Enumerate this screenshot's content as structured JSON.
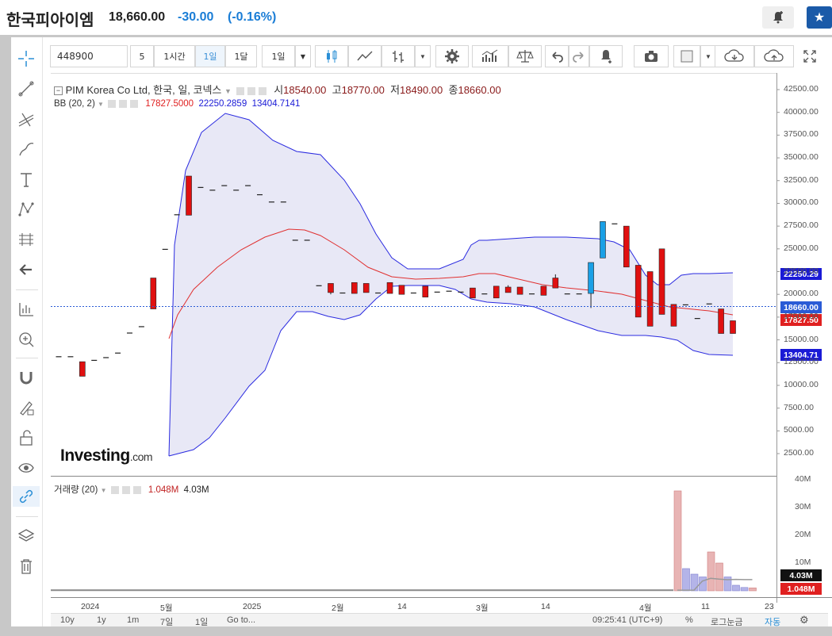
{
  "header": {
    "title": "한국피아이엠",
    "price": "18,660.00",
    "change": "-30.00",
    "change_pct": "(-0.16%)",
    "colors": {
      "down": "#1a7dd6"
    },
    "icons": [
      "bell-plus-icon",
      "star-icon"
    ]
  },
  "toolbar": {
    "symbol_value": "448900",
    "interval_5": "5",
    "interval_1h": "1시간",
    "interval_1d": "1일",
    "interval_1w": "1달",
    "interval_select": "1일",
    "icons": [
      "candles-icon",
      "line-chart-icon",
      "bar-chart-icon",
      "gear-icon",
      "indicators-icon",
      "scale-icon",
      "undo-icon",
      "redo-icon",
      "alert-icon",
      "camera-icon",
      "color-box-icon",
      "cloud-download-icon",
      "cloud-upload-icon",
      "fullscreen-icon"
    ]
  },
  "legend": {
    "symbol_line": "PIM Korea Co Ltd, 한국, 일, 코넥스",
    "open_label": "시",
    "open": "18540.00",
    "high_label": "고",
    "high": "18770.00",
    "low_label": "저",
    "low": "18490.00",
    "close_label": "종",
    "close": "18660.00",
    "bb_label": "BB (20, 2)",
    "bb_mid": "17827.5000",
    "bb_upper": "22250.2859",
    "bb_lower": "13404.7141",
    "vol_label": "거래량 (20)",
    "vol_value": "1.048M",
    "vol_ma": "4.03M"
  },
  "watermark": {
    "brand": "Investing",
    "suffix": ".com"
  },
  "axis_tags": {
    "bb_upper": "22250.29",
    "last": "18660.00",
    "bb_mid": "17827.50",
    "bb_lower": "13404.71",
    "vol_ma": "4.03M",
    "vol": "1.048M",
    "colors": {
      "upper": "#1a1ad6",
      "last": "#2a5bd6",
      "mid": "#e02020",
      "lower": "#1a1ad6",
      "vol_ma": "#111111",
      "vol": "#e02020"
    }
  },
  "bottom_bar": {
    "ranges": [
      "10y",
      "1y",
      "1m",
      "7일",
      "1일"
    ],
    "goto": "Go to...",
    "time": "09:25:41 (UTC+9)",
    "pct": "%",
    "log": "로그눈금",
    "auto": "자동"
  },
  "sidebar": {
    "icons": [
      "crosshair-icon",
      "trendline-icon",
      "fib-icon",
      "brush-icon",
      "text-icon",
      "pattern-icon",
      "measure-icon",
      "back-arrow-icon",
      "ruler-icon",
      "zoom-in-icon",
      "magnet-icon",
      "lock-pencil-icon",
      "unlock-icon",
      "eye-icon",
      "link-icon",
      "layers-icon",
      "trash-icon"
    ]
  },
  "chart_data": [
    {
      "type": "candlestick",
      "title": "PIM Korea Co Ltd, 한국, 일, 코넥스",
      "y_axis_ticks": [
        "42500.00",
        "40000.00",
        "37500.00",
        "35000.00",
        "32500.00",
        "30000.00",
        "27500.00",
        "25000.00",
        "22500.00",
        "20000.00",
        "17500.00",
        "15000.00",
        "12500.00",
        "10000.00",
        "7500.00",
        "5000.00",
        "2500.00"
      ],
      "x_axis_ticks": [
        "2024",
        "5월",
        "2025",
        "2월",
        "14",
        "3월",
        "14",
        "4월",
        "11",
        "23"
      ],
      "ylim": [
        0,
        43750
      ],
      "candles": [
        {
          "o": 13200,
          "h": 13200,
          "l": 13200,
          "c": 13200
        },
        {
          "o": 13200,
          "h": 13200,
          "l": 13200,
          "c": 13200
        },
        {
          "o": 12600,
          "h": 12600,
          "l": 11000,
          "c": 11000
        },
        {
          "o": 12800,
          "h": 12800,
          "l": 12800,
          "c": 12800
        },
        {
          "o": 13100,
          "h": 13100,
          "l": 13100,
          "c": 13100
        },
        {
          "o": 13600,
          "h": 13600,
          "l": 13600,
          "c": 13600
        },
        {
          "o": 15800,
          "h": 15800,
          "l": 15800,
          "c": 15800
        },
        {
          "o": 16500,
          "h": 16500,
          "l": 16500,
          "c": 16500
        },
        {
          "o": 21800,
          "h": 21800,
          "l": 18400,
          "c": 18400
        },
        {
          "o": 25000,
          "h": 25000,
          "l": 25000,
          "c": 25000
        },
        {
          "o": 28800,
          "h": 28800,
          "l": 28800,
          "c": 28800
        },
        {
          "o": 33000,
          "h": 33000,
          "l": 28700,
          "c": 28700
        },
        {
          "o": 31800,
          "h": 31800,
          "l": 31800,
          "c": 31800
        },
        {
          "o": 31500,
          "h": 31500,
          "l": 31500,
          "c": 31500
        },
        {
          "o": 32000,
          "h": 32000,
          "l": 32000,
          "c": 32000
        },
        {
          "o": 31500,
          "h": 31500,
          "l": 31500,
          "c": 31500
        },
        {
          "o": 32000,
          "h": 32000,
          "l": 32000,
          "c": 32000
        },
        {
          "o": 31000,
          "h": 31000,
          "l": 31000,
          "c": 31000
        },
        {
          "o": 30200,
          "h": 30200,
          "l": 30200,
          "c": 30200
        },
        {
          "o": 30200,
          "h": 30200,
          "l": 30200,
          "c": 30200
        },
        {
          "o": 26000,
          "h": 26000,
          "l": 26000,
          "c": 26000
        },
        {
          "o": 26000,
          "h": 26000,
          "l": 26000,
          "c": 26000
        },
        {
          "o": 21000,
          "h": 21000,
          "l": 21000,
          "c": 21000
        },
        {
          "o": 21200,
          "h": 21200,
          "l": 20000,
          "c": 20200
        },
        {
          "o": 20200,
          "h": 20200,
          "l": 20200,
          "c": 20200
        },
        {
          "o": 21300,
          "h": 21300,
          "l": 20100,
          "c": 20100
        },
        {
          "o": 21200,
          "h": 21200,
          "l": 20200,
          "c": 20200
        },
        {
          "o": 20200,
          "h": 20200,
          "l": 20200,
          "c": 20200
        },
        {
          "o": 21300,
          "h": 21300,
          "l": 20100,
          "c": 20100
        },
        {
          "o": 21000,
          "h": 21000,
          "l": 20000,
          "c": 20000
        },
        {
          "o": 20200,
          "h": 20200,
          "l": 20200,
          "c": 20200
        },
        {
          "o": 20900,
          "h": 20900,
          "l": 19700,
          "c": 19700
        },
        {
          "o": 20300,
          "h": 20300,
          "l": 20300,
          "c": 20300
        },
        {
          "o": 20400,
          "h": 20400,
          "l": 20400,
          "c": 20400
        },
        {
          "o": 20300,
          "h": 20300,
          "l": 20300,
          "c": 20300
        },
        {
          "o": 20700,
          "h": 20700,
          "l": 19600,
          "c": 19600
        },
        {
          "o": 20100,
          "h": 20100,
          "l": 20100,
          "c": 20100
        },
        {
          "o": 20900,
          "h": 20900,
          "l": 19600,
          "c": 19600
        },
        {
          "o": 20800,
          "h": 21000,
          "l": 20200,
          "c": 20200
        },
        {
          "o": 20800,
          "h": 20800,
          "l": 20000,
          "c": 20000
        },
        {
          "o": 20100,
          "h": 20100,
          "l": 20100,
          "c": 20100
        },
        {
          "o": 20900,
          "h": 20900,
          "l": 19900,
          "c": 19900
        },
        {
          "o": 21800,
          "h": 22200,
          "l": 20700,
          "c": 20700
        },
        {
          "o": 20100,
          "h": 20100,
          "l": 20100,
          "c": 20100
        },
        {
          "o": 20100,
          "h": 20100,
          "l": 20100,
          "c": 20100
        },
        {
          "o": 20100,
          "h": 21500,
          "l": 18500,
          "c": 23500
        },
        {
          "o": 24000,
          "h": 28000,
          "l": 24000,
          "c": 28000
        },
        {
          "o": 27800,
          "h": 27800,
          "l": 27800,
          "c": 27800
        },
        {
          "o": 27500,
          "h": 27500,
          "l": 23000,
          "c": 23000
        },
        {
          "o": 23200,
          "h": 23200,
          "l": 17500,
          "c": 17500
        },
        {
          "o": 22500,
          "h": 22500,
          "l": 16500,
          "c": 16500
        },
        {
          "o": 25000,
          "h": 25000,
          "l": 17800,
          "c": 17800
        },
        {
          "o": 18900,
          "h": 18900,
          "l": 16500,
          "c": 16500
        },
        {
          "o": 18900,
          "h": 18900,
          "l": 18900,
          "c": 18900
        },
        {
          "o": 17400,
          "h": 17400,
          "l": 17400,
          "c": 17400
        },
        {
          "o": 19000,
          "h": 19000,
          "l": 19000,
          "c": 19000
        },
        {
          "o": 18400,
          "h": 18400,
          "l": 15700,
          "c": 15700
        },
        {
          "o": 17100,
          "h": 17100,
          "l": 15700,
          "c": 15700
        }
      ],
      "bb_upper_approx": [
        2500,
        40000,
        37000,
        33000,
        26000,
        21500,
        21000,
        24000,
        26000,
        25800,
        20000,
        22250
      ],
      "bb_mid_approx": [
        18400,
        27000,
        26500,
        22000,
        21000,
        20500,
        19000,
        17800
      ],
      "bb_lower_approx": [
        2500,
        9000,
        15000,
        16800,
        19600,
        17000,
        13404
      ],
      "last_price": 18660
    },
    {
      "type": "bar",
      "title": "거래량 (20)",
      "y_axis_ticks": [
        "40M",
        "30M",
        "20M",
        "10M"
      ],
      "ylim": [
        0,
        40
      ],
      "values_M": [
        36,
        8,
        6,
        5,
        14,
        10,
        5,
        2,
        1.2,
        1.048
      ],
      "ma_M": [
        0.2,
        0.2,
        0.2,
        3.5,
        4.5,
        4.2,
        4.0,
        4.1,
        4.05,
        4.03
      ]
    }
  ]
}
